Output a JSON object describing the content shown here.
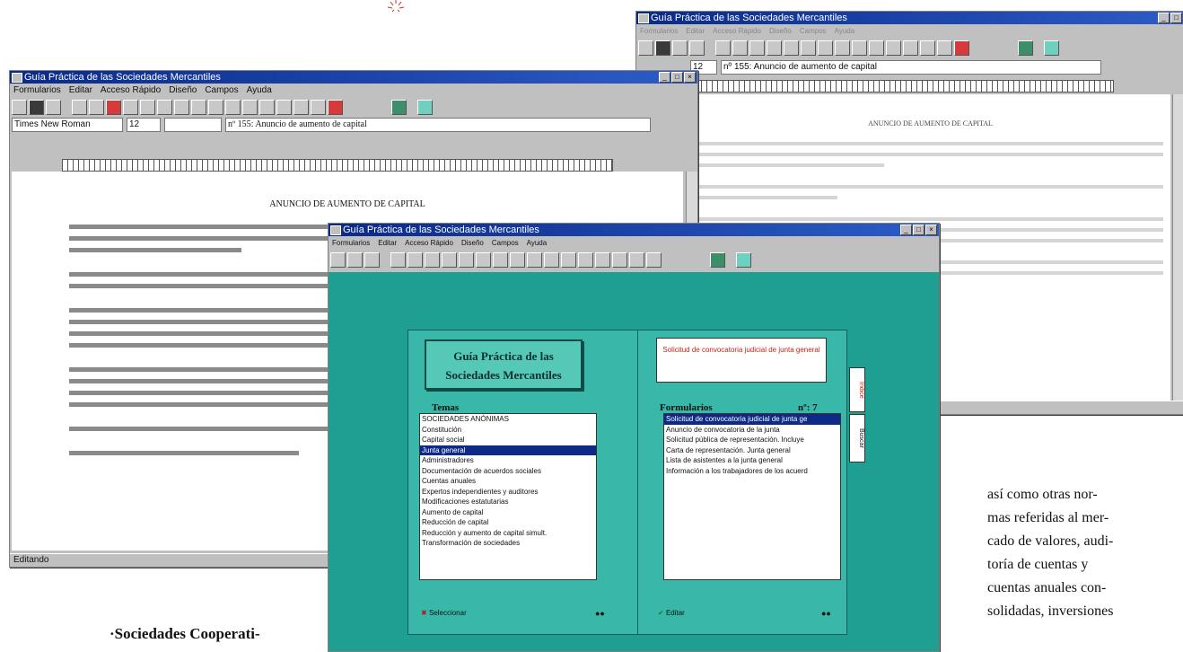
{
  "window_title": "Guía Práctica de las Sociedades Mercantiles",
  "menu": [
    "Formularios",
    "Editar",
    "Acceso Rápido",
    "Diseño",
    "Campos",
    "Ayuda"
  ],
  "font_name": "Times New Roman",
  "font_size": "12",
  "doc_title_field": "nº 155: Anuncio de aumento de capital",
  "doc_heading": "ANUNCIO DE AUMENTO DE CAPITAL",
  "status": "Editando",
  "front": {
    "title_line1": "Guía Práctica de las",
    "title_line2": "Sociedades Mercantiles",
    "temas_label": "Temas",
    "formularios_label": "Formularios",
    "count_label": "nº: 7",
    "preview_text": "Solicitud de convocatoria judicial de junta general",
    "tab_index": "Índice",
    "tab_search": "Buscar",
    "btn_left": "Seleccionar",
    "btn_right": "Editar",
    "temas": [
      "SOCIEDADES ANÓNIMAS",
      "Constitución",
      "Capital social",
      "Junta general",
      "Administradores",
      "Documentación de acuerdos sociales",
      "Cuentas anuales",
      "Expertos independientes y auditores",
      "Modificaciones estatutarias",
      "Aumento de capital",
      "Reducción de capital",
      "Reducción y aumento de capital simult.",
      "Transformación de sociedades"
    ],
    "formularios": [
      "Solicitud de convocatoria judicial de junta ge",
      "Anuncio de convocatoria de la junta",
      "Solicitud pública de representación. Incluye",
      "Carta de representación. Junta general",
      "Lista de asistentes a la junta general",
      "Información a los trabajadores de los acuerd"
    ]
  },
  "left_text": "·Sociedades Cooperati-",
  "right_text": [
    "así como otras nor-",
    "mas referidas al mer-",
    "cado de valores, audi-",
    "toría de cuentas y",
    "cuentas anuales con-",
    "solidadas, inversiones"
  ]
}
